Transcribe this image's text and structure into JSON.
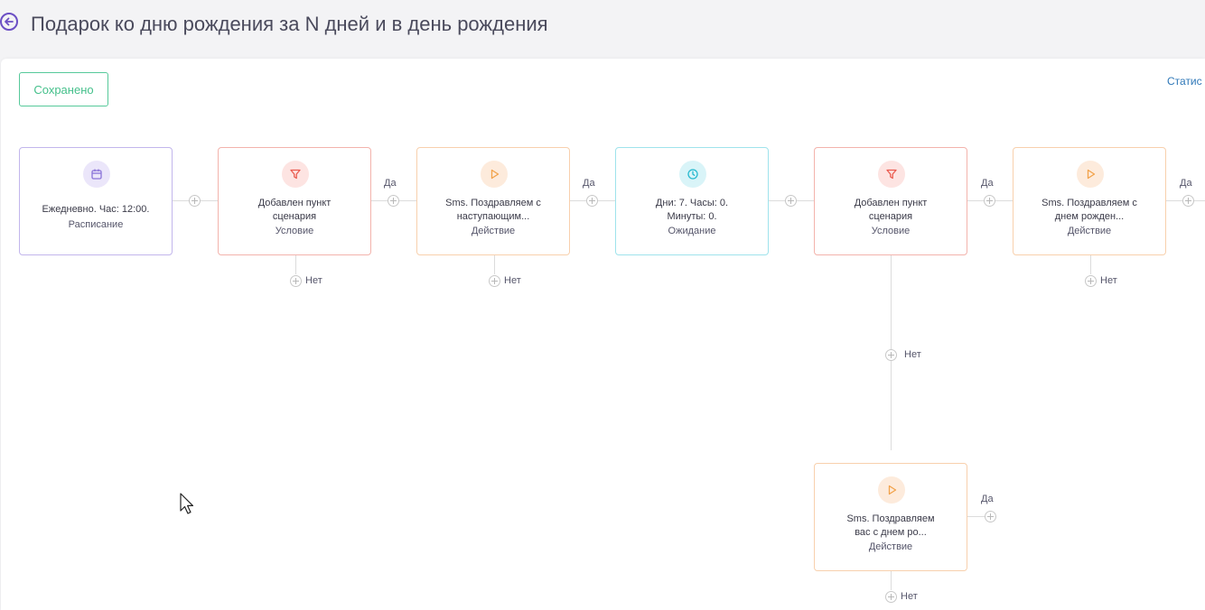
{
  "header": {
    "title": "Подарок ко дню рождения за N дней и в день рождения"
  },
  "toolbar": {
    "saved_label": "Сохранено",
    "stats_label": "Статис"
  },
  "labels": {
    "yes": "Да",
    "no": "Нет"
  },
  "nodes": [
    {
      "kind": "schedule",
      "icon": "calendar-icon",
      "text": "Ежедневно. Час: 12:00.",
      "type": "Расписание"
    },
    {
      "kind": "condition",
      "icon": "filter-icon",
      "text": "Добавлен пункт\nсценария",
      "type": "Условие"
    },
    {
      "kind": "action",
      "icon": "play-icon",
      "text": "Sms. Поздравляем с\nнаступающим...",
      "type": "Действие"
    },
    {
      "kind": "wait",
      "icon": "clock-icon",
      "text": "Дни: 7. Часы: 0.\nМинуты: 0.",
      "type": "Ожидание"
    },
    {
      "kind": "condition",
      "icon": "filter-icon",
      "text": "Добавлен пункт\nсценария",
      "type": "Условие"
    },
    {
      "kind": "action",
      "icon": "play-icon",
      "text": "Sms. Поздравляем с\nднем рожден...",
      "type": "Действие"
    },
    {
      "kind": "action",
      "icon": "play-icon",
      "text": "Sms. Поздравляем\nвас с днем ро...",
      "type": "Действие"
    }
  ],
  "colors": {
    "schedule": "#8b74d8",
    "condition": "#ea5a4e",
    "action": "#f2a24a",
    "wait": "#27b9cf",
    "saved": "#45c08b",
    "link": "#2f78b8"
  }
}
